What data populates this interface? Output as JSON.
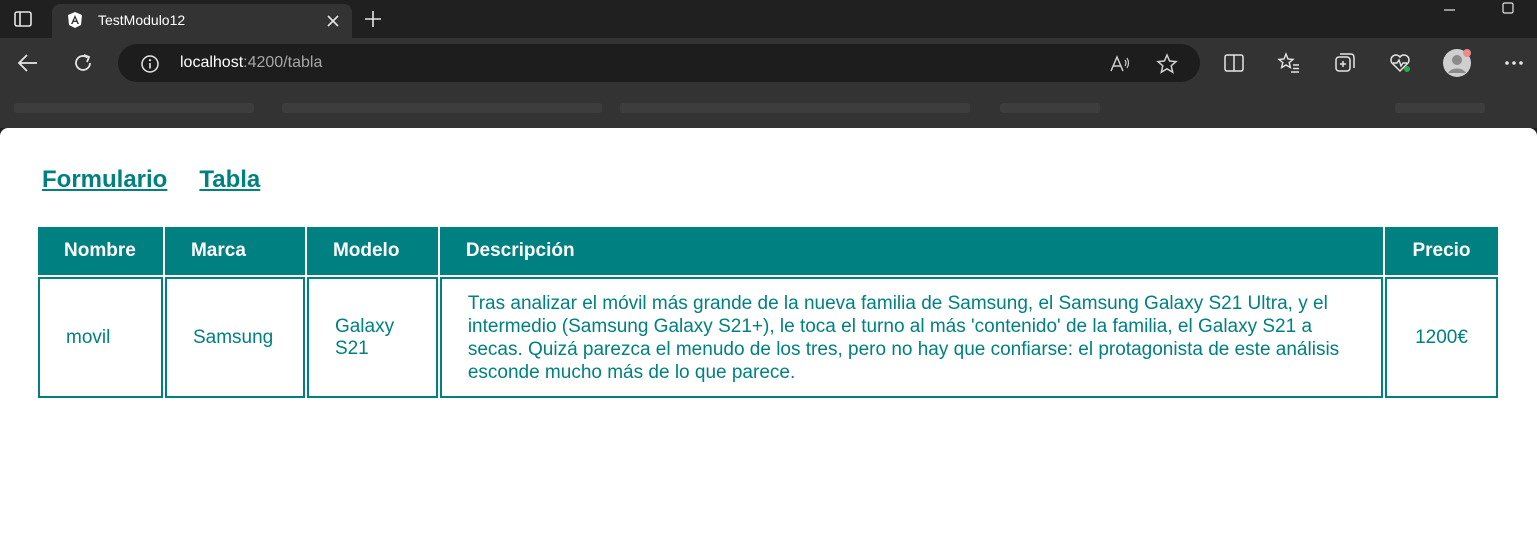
{
  "browser": {
    "tab_title": "TestModulo12",
    "url_host": "localhost",
    "url_rest": ":4200/tabla",
    "colors": {
      "chrome_dark": "#202020",
      "chrome": "#333333",
      "address": "#1d1d1d"
    }
  },
  "nav": {
    "links": [
      "Formulario",
      "Tabla"
    ]
  },
  "table": {
    "headers": [
      "Nombre",
      "Marca",
      "Modelo",
      "Descripción",
      "Precio"
    ],
    "rows": [
      {
        "nombre": "movil",
        "marca": "Samsung",
        "modelo": "Galaxy S21",
        "descripcion": "Tras analizar el móvil más grande de la nueva familia de Samsung, el Samsung Galaxy S21 Ultra, y el intermedio (Samsung Galaxy S21+), le toca el turno al más 'contenido' de la familia, el Galaxy S21 a secas. Quizá parezca el menudo de los tres, pero no hay que confiarse: el protagonista de este análisis esconde mucho más de lo que parece.",
        "precio": "1200€"
      }
    ]
  },
  "theme": {
    "accent": "#008080",
    "background": "#ffffff"
  }
}
